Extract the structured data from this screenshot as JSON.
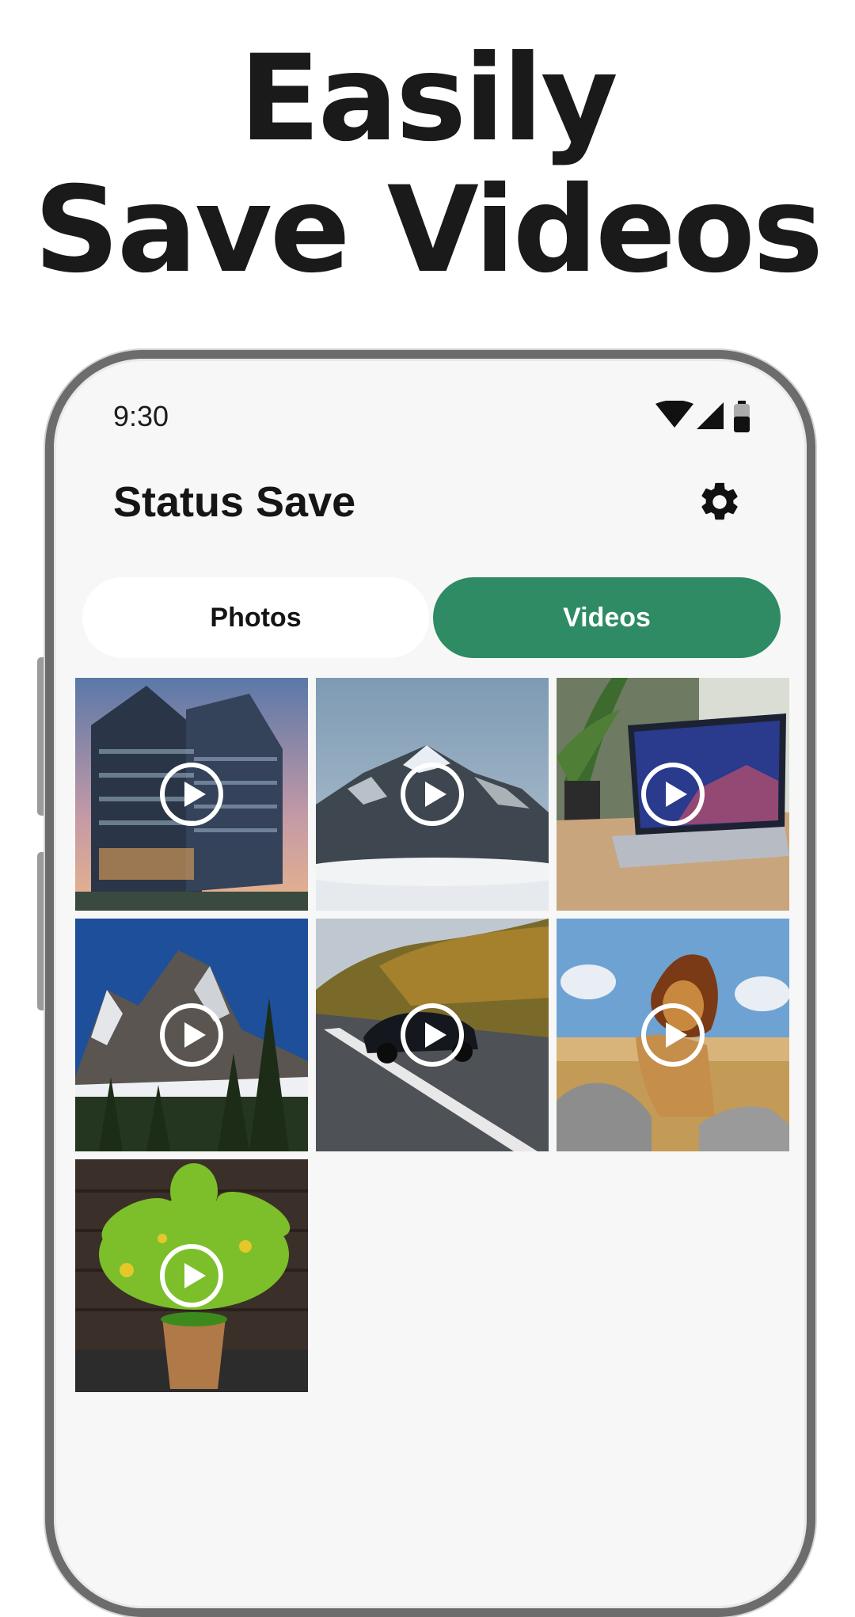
{
  "headline": {
    "line1": "Easily",
    "line2": "Save Videos"
  },
  "status_bar": {
    "time": "9:30",
    "icons": [
      "wifi-icon",
      "signal-icon",
      "battery-icon"
    ]
  },
  "app_bar": {
    "title": "Status Save",
    "settings_icon": "gear-icon"
  },
  "tabs": [
    {
      "label": "Photos",
      "selected": false
    },
    {
      "label": "Videos",
      "selected": true
    }
  ],
  "colors": {
    "accent": "#2e8b63",
    "background": "#f7f7f7",
    "text": "#151515"
  },
  "videos": [
    {
      "subject": "office-building",
      "icon": "play-icon"
    },
    {
      "subject": "snowy-mountain",
      "icon": "play-icon"
    },
    {
      "subject": "laptop-on-desk",
      "icon": "play-icon"
    },
    {
      "subject": "rocky-peak-forest",
      "icon": "play-icon"
    },
    {
      "subject": "sports-car-road",
      "icon": "play-icon"
    },
    {
      "subject": "lion-on-rock",
      "icon": "play-icon"
    },
    {
      "subject": "potted-fern",
      "icon": "play-icon"
    }
  ]
}
